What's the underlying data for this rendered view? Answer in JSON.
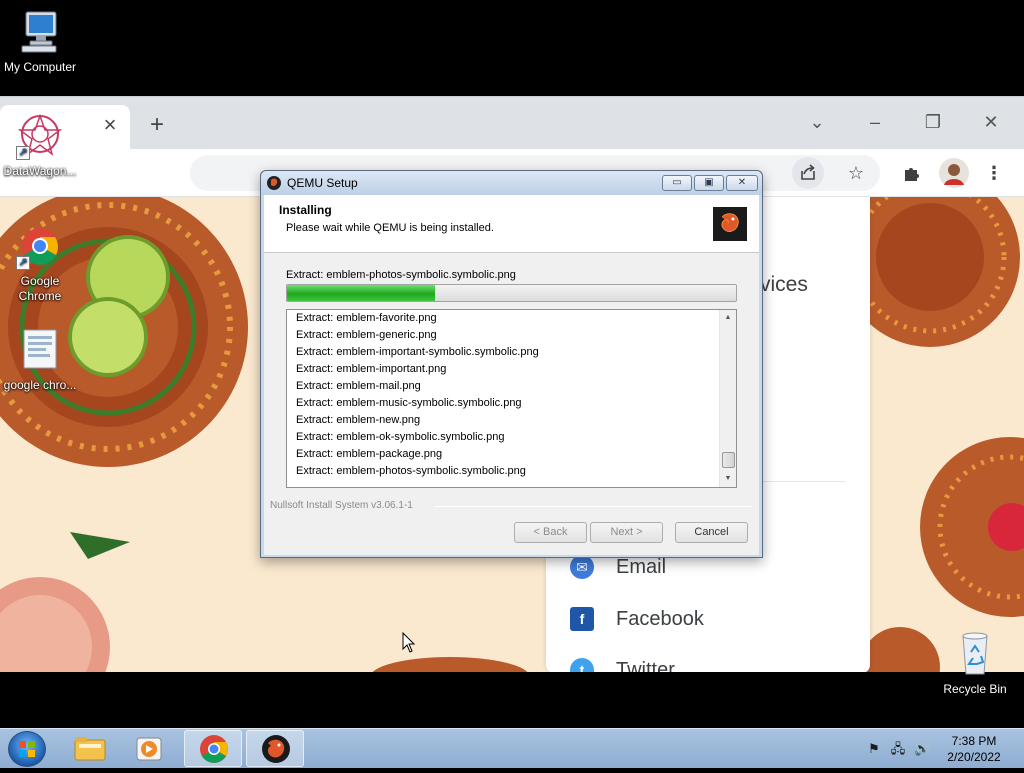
{
  "desktop": {
    "icons": [
      {
        "label": "My Computer"
      },
      {
        "label": "DataWagon..."
      },
      {
        "label": "Google Chrome"
      },
      {
        "label": "google chro..."
      },
      {
        "label": "Recycle Bin"
      }
    ]
  },
  "browser": {
    "share_panel": {
      "partial_heading": "vices",
      "items": [
        {
          "label": "Email",
          "icon": "email-icon"
        },
        {
          "label": "Facebook",
          "icon": "facebook-icon"
        },
        {
          "label": "Twitter",
          "icon": "twitter-icon"
        }
      ]
    }
  },
  "dialog": {
    "title": "QEMU Setup",
    "header_title": "Installing",
    "header_subtitle": "Please wait while QEMU is being installed.",
    "status": "Extract: emblem-photos-symbolic.symbolic.png",
    "progress": 0.33,
    "log": [
      "Extract: emblem-favorite.png",
      "Extract: emblem-generic.png",
      "Extract: emblem-important-symbolic.symbolic.png",
      "Extract: emblem-important.png",
      "Extract: emblem-mail.png",
      "Extract: emblem-music-symbolic.symbolic.png",
      "Extract: emblem-new.png",
      "Extract: emblem-ok-symbolic.symbolic.png",
      "Extract: emblem-package.png",
      "Extract: emblem-photos-symbolic.symbolic.png"
    ],
    "brand": "Nullsoft Install System v3.06.1-1",
    "buttons": {
      "back": "< Back",
      "next": "Next >",
      "cancel": "Cancel"
    }
  },
  "taskbar": {
    "apps": [
      {
        "name": "file-explorer-icon"
      },
      {
        "name": "media-player-icon"
      },
      {
        "name": "chrome-icon"
      },
      {
        "name": "qemu-setup-icon"
      }
    ],
    "time": "7:38 PM",
    "date": "2/20/2022"
  },
  "colors": {
    "progress": "#1ea81e",
    "taskbar": "#9bb8da",
    "wallpaper": "#fbe9cf",
    "plate": "#b8522a"
  }
}
